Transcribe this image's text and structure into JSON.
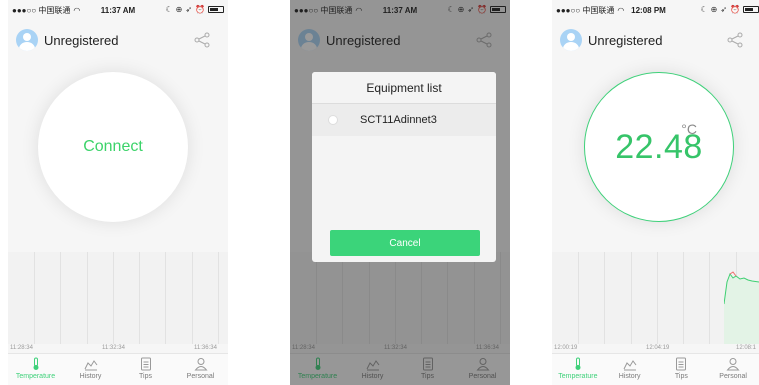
{
  "colors": {
    "accent": "#3cd36a",
    "cancel_button_bg": "#3bd47a"
  },
  "screens": [
    {
      "status": {
        "carrier": "●●●○○ 中国联通",
        "time": "11:37 AM"
      },
      "header": {
        "user": "Unregistered"
      },
      "dial": {
        "label": "Connect"
      },
      "chart_ticks": [
        "11:28:34",
        "11:32:34",
        "11:36:34"
      ],
      "tabs": [
        "Temperature",
        "History",
        "Tips",
        "Personal"
      ]
    },
    {
      "status": {
        "carrier": "●●●○○ 中国联通",
        "time": "11:37 AM"
      },
      "header": {
        "user": "Unregistered"
      },
      "modal": {
        "title": "Equipment list",
        "device": "SCT11Adinnet3",
        "cancel": "Cancel"
      },
      "chart_ticks": [
        "11:28:34",
        "11:32:34",
        "11:36:34"
      ],
      "tabs": [
        "Temperature",
        "History",
        "Tips",
        "Personal"
      ]
    },
    {
      "status": {
        "carrier": "●●●○○ 中国联通",
        "time": "12:08 PM"
      },
      "header": {
        "user": "Unregistered"
      },
      "dial": {
        "value": "22.48",
        "unit": "°C"
      },
      "chart_ticks": [
        "12:00:19",
        "12:04:19",
        "12:08:1"
      ],
      "tabs": [
        "Temperature",
        "History",
        "Tips",
        "Personal"
      ]
    }
  ]
}
